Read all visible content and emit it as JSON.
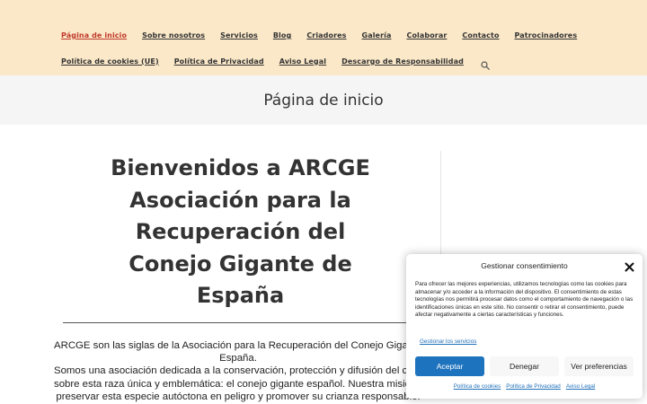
{
  "nav": {
    "row1": [
      "Página de inicio",
      "Sobre nosotros",
      "Servicios",
      "Blog",
      "Criadores",
      "Galería",
      "Colaborar",
      "Contacto",
      "Patrocinadores"
    ],
    "row2": [
      "Política de cookies (UE)",
      "Política de Privacidad",
      "Aviso Legal",
      "Descargo de Responsabilidad"
    ],
    "search_icon": "search-icon"
  },
  "page_header": {
    "title": "Página de inicio"
  },
  "hero": {
    "lines": [
      "Bienvenidos a ARCGE",
      "Asociación para la",
      "Recuperación del",
      "Conejo Gigante de",
      "España"
    ]
  },
  "intro": {
    "lines": [
      "ARCGE son las siglas de la Asociación para la Recuperación del Conejo Gigante de",
      "España.",
      "Somos una asociación dedicada a la conservación, protección y difusión del conocimiento",
      "sobre esta raza única y emblemática: el conejo gigante español. Nuestra misión es",
      "preservar esta especie autóctona en peligro y promover su crianza responsable."
    ]
  },
  "consent": {
    "title": "Gestionar consentimiento",
    "close_icon": "close-icon",
    "text": "Para ofrecer las mejores experiencias, utilizamos tecnologías como las cookies para almacenar y/o acceder a la información del dispositivo. El consentimiento de estas tecnologías nos permitirá procesar datos como el comportamiento de navegación o las identificaciones únicas en este sitio. No consentir o retirar el consentimiento, puede afectar negativamente a ciertas características y funciones.",
    "services_link": "Gestionar los servicios",
    "accept_label": "Aceptar",
    "deny_label": "Denegar",
    "prefs_label": "Ver preferencias",
    "links": [
      "Política de cookies",
      "Política de Privacidad",
      "Aviso Legal"
    ],
    "accent": "#1e73be"
  },
  "colors": {
    "nav_bg": "#fbe8c8",
    "active": "#c0392b",
    "header_bg": "#f5f5f5"
  }
}
